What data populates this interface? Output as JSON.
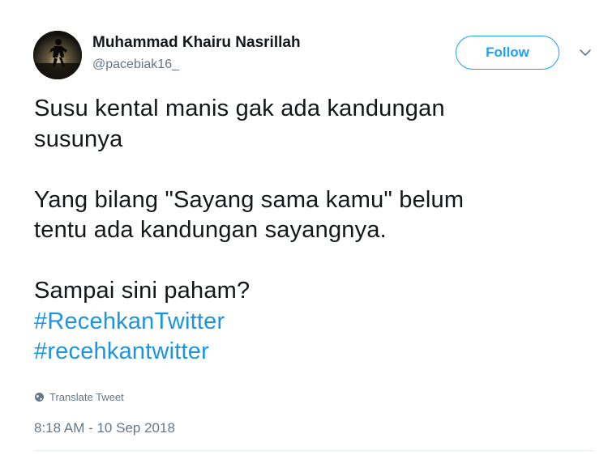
{
  "author": {
    "name": "Muhammad Khairu Nasrillah",
    "handle": "@pacebiak16_",
    "avatar_icon": "profile-photo"
  },
  "actions": {
    "follow_label": "Follow",
    "more_icon": "chevron-down-icon"
  },
  "tweet": {
    "lines": [
      "Susu kental manis gak ada kandungan",
      "susunya",
      "Yang bilang \"Sayang sama kamu\" belum",
      "tentu ada kandungan sayangnya.",
      "Sampai sini paham?"
    ],
    "hashtags": [
      "#RecehkanTwitter",
      "#recehkantwitter"
    ],
    "translate_label": "Translate Tweet",
    "timestamp": "8:18 AM - 10 Sep 2018"
  },
  "colors": {
    "accent": "#1da1f2",
    "hashtag": "#1b95e0",
    "text": "#14171a",
    "muted": "#657786"
  }
}
